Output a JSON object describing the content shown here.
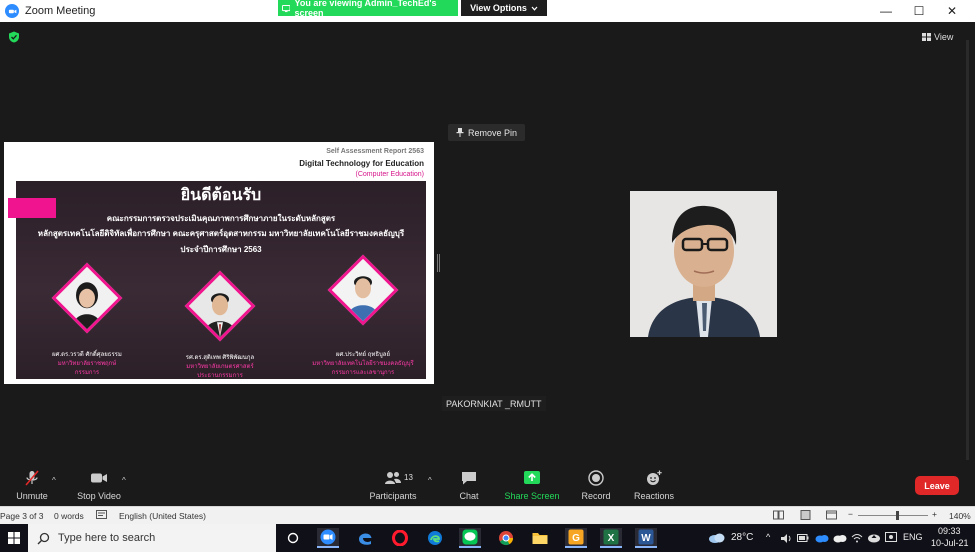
{
  "window": {
    "title": "Zoom Meeting",
    "banner": "You are viewing Admin_TechEd's screen",
    "view_options": "View Options",
    "minimize": "—",
    "maximize": "☐",
    "close": "✕"
  },
  "meeting": {
    "view_label": "View",
    "remove_pin": "Remove Pin",
    "participant_name": "PAKORNKIAT _RMUTT"
  },
  "slide": {
    "report": "Self Assessment Report 2563",
    "program": "Digital Technology for Education",
    "program_sub": "(Computer Education)",
    "welcome": "ยินดีต้อนรับ",
    "line1": "คณะกรรมการตรวจประเมินคุณภาพการศึกษาภายในระดับหลักสูตร",
    "line2": "หลักสูตรเทคโนโลยีดิจิทัลเพื่อการศึกษา คณะครุศาสตร์อุตสาหกรรม มหาวิทยาลัยเทคโนโลยีราชมงคลธัญบุรี",
    "line3": "ประจำปีการศึกษา 2563",
    "people": [
      {
        "name": "ผศ.ดร.วรวดี ศักดิ์ศุลยธรรม",
        "org": "มหาวิทยาลัยราชพฤกษ์",
        "role": "กรรมการ"
      },
      {
        "name": "รศ.ดร.สุติเทพ ศิริพิพัฒนกุล",
        "org": "มหาวิทยาลัยเกษตรศาสตร์",
        "role": "ประธานกรรมการ"
      },
      {
        "name": "ผศ.ประวิทย์ ฤทธิบูลย์",
        "org": "มหาวิทยาลัยเทคโนโลยีราชมงคลธัญบุรี",
        "role": "กรรมการและเลขานุการ"
      }
    ]
  },
  "toolbar": {
    "unmute": "Unmute",
    "stop_video": "Stop Video",
    "participants": "Participants",
    "participants_count": "13",
    "chat": "Chat",
    "share_screen": "Share Screen",
    "record": "Record",
    "reactions": "Reactions",
    "leave": "Leave",
    "caret": "^"
  },
  "statusbar": {
    "page": "Page 3 of 3",
    "words": "0 words",
    "language": "English (United States)",
    "minus": "−",
    "plus": "+",
    "zoom": "140%"
  },
  "taskbar": {
    "search_placeholder": "Type here to search",
    "temperature": "28°C",
    "lang": "ENG",
    "time": "09:33",
    "date": "10-Jul-21"
  },
  "colors": {
    "accent_green": "#23d959",
    "leave_red": "#e02828",
    "slide_pink": "#f0148e"
  }
}
